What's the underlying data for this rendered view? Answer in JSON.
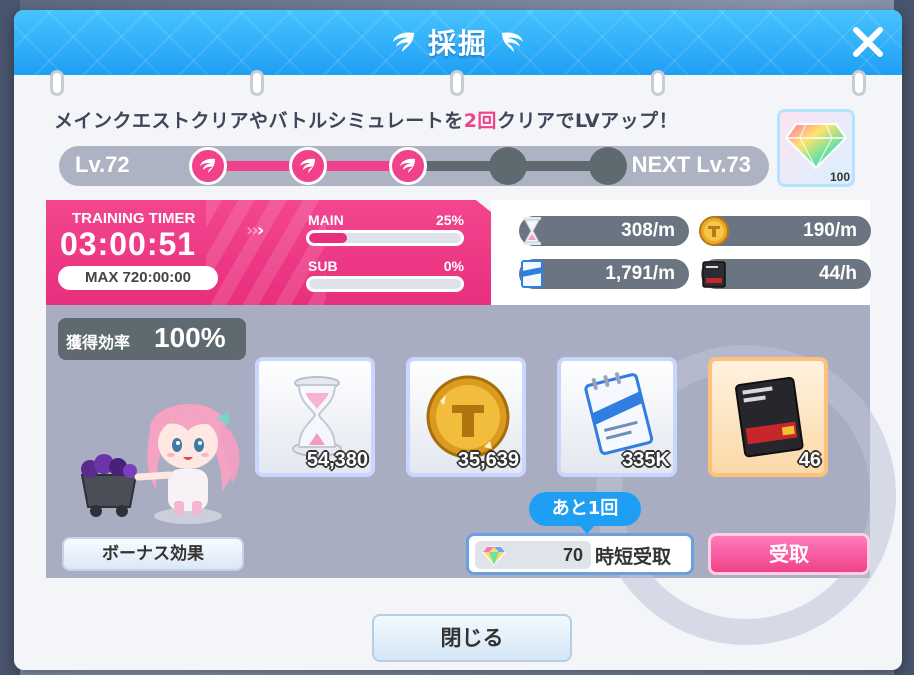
{
  "dialog": {
    "title": "採掘",
    "close_icon": "close-icon"
  },
  "level": {
    "description_pre": "メインクエストクリアやバトルシミュレートを",
    "description_count": "2回",
    "description_post": "クリアでLVアップ！",
    "current": "Lv.72",
    "next": "NEXT Lv.73",
    "progress_steps_total": 5,
    "progress_steps_done": 3,
    "reward_icon": "rainbow-gem-icon",
    "reward_count": "100"
  },
  "timer": {
    "label": "TRAINING TIMER",
    "value": "03:00:51",
    "max": "MAX 720:00:00",
    "main_label": "MAIN",
    "main_pct": "25%",
    "main_fill": 0.25,
    "sub_label": "SUB",
    "sub_pct": "0%",
    "sub_fill": 0.0
  },
  "rates": [
    {
      "icon": "hourglass-icon",
      "value": "308/m"
    },
    {
      "icon": "coin-icon",
      "value": "190/m"
    },
    {
      "icon": "training-report-icon",
      "value": "1,791/m"
    },
    {
      "icon": "technical-report-icon",
      "value": "44/h"
    }
  ],
  "efficiency": {
    "label": "獲得効率",
    "value": "100%"
  },
  "items": [
    {
      "icon": "hourglass-icon",
      "count": "54,380"
    },
    {
      "icon": "coin-icon",
      "count": "35,639"
    },
    {
      "icon": "training-report-icon",
      "count": "335K"
    },
    {
      "icon": "technical-report-icon",
      "count": "46"
    }
  ],
  "actions": {
    "bonus_label": "ボーナス効果",
    "remaining": "あと1回",
    "shorten_cost": "70",
    "shorten_label": "時短受取",
    "receive_label": "受取",
    "close_label": "閉じる"
  },
  "colors": {
    "header": "#1f9ff4",
    "accent_pink": "#f0418a",
    "panel_gray": "#a8adc1",
    "pill_dark": "#5e6a70"
  }
}
